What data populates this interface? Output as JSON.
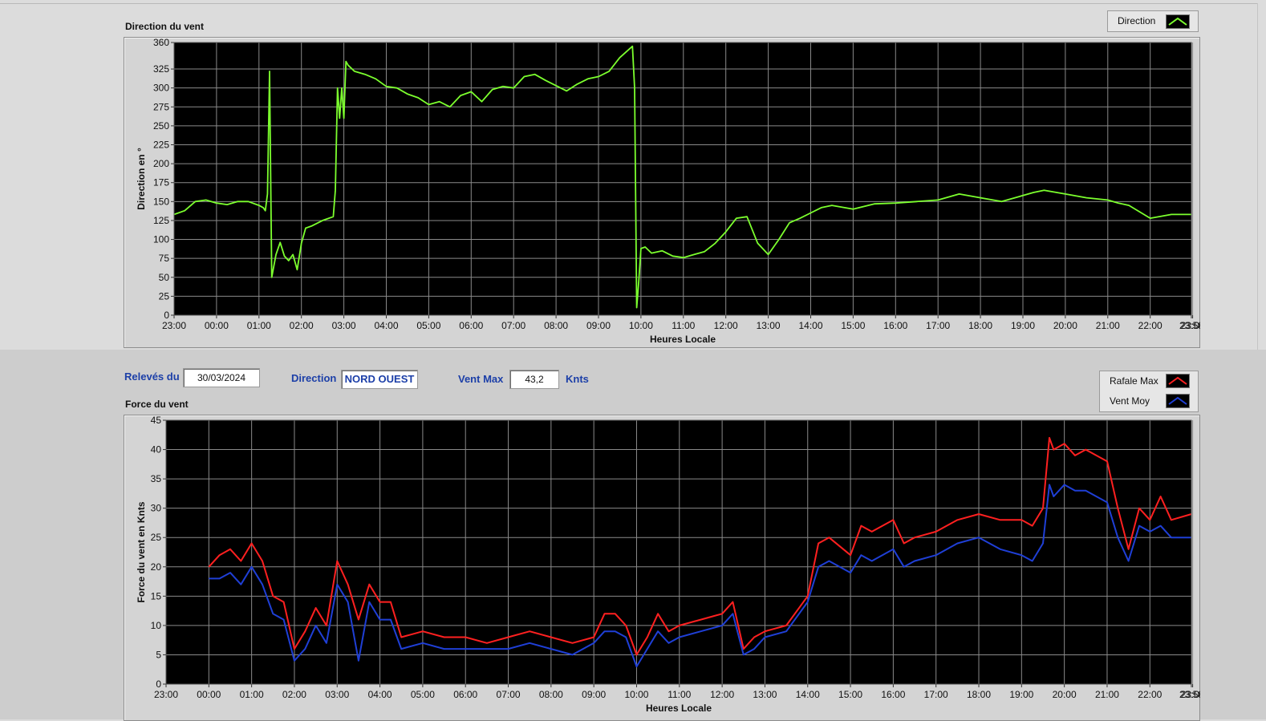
{
  "dir_chart": {
    "title": "Direction du vent",
    "legend": {
      "label": "Direction",
      "color": "#7cff2e"
    },
    "chart_data": {
      "type": "line",
      "title": "Direction du vent",
      "xlabel": "Heures Locale",
      "ylabel": "Direction en °",
      "ylim": [
        0,
        360
      ],
      "yticks": [
        "0",
        "25",
        "50",
        "75",
        "100",
        "125",
        "150",
        "175",
        "200",
        "225",
        "250",
        "275",
        "300",
        "325",
        "360"
      ],
      "yticks_values": [
        0,
        25,
        50,
        75,
        100,
        125,
        150,
        175,
        200,
        225,
        250,
        275,
        300,
        325,
        360
      ],
      "xticks": [
        "23:00",
        "00:00",
        "01:00",
        "02:00",
        "03:00",
        "04:00",
        "05:00",
        "06:00",
        "07:00",
        "08:00",
        "09:00",
        "10:00",
        "11:00",
        "12:00",
        "13:00",
        "14:00",
        "15:00",
        "16:00",
        "17:00",
        "18:00",
        "19:00",
        "20:00",
        "21:00",
        "22:00",
        "23:00",
        "23:58"
      ],
      "grid": true,
      "series": [
        {
          "name": "Direction",
          "color": "#7cff2e",
          "x": [
            0.0,
            0.25,
            0.5,
            0.75,
            1.0,
            1.25,
            1.5,
            1.75,
            2.0,
            2.1,
            2.15,
            2.2,
            2.25,
            2.3,
            2.4,
            2.5,
            2.6,
            2.7,
            2.8,
            2.9,
            3.0,
            3.1,
            3.25,
            3.5,
            3.75,
            3.8,
            3.85,
            3.9,
            3.95,
            4.0,
            4.05,
            4.1,
            4.25,
            4.5,
            4.75,
            5.0,
            5.25,
            5.5,
            5.75,
            6.0,
            6.25,
            6.5,
            6.75,
            7.0,
            7.25,
            7.5,
            7.75,
            8.0,
            8.25,
            8.5,
            8.75,
            9.0,
            9.25,
            9.5,
            9.75,
            10.0,
            10.25,
            10.5,
            10.7,
            10.8,
            10.85,
            10.9,
            10.95,
            11.0,
            11.1,
            11.25,
            11.5,
            11.75,
            12.0,
            12.25,
            12.5,
            12.75,
            13.0,
            13.25,
            13.5,
            13.75,
            14.0,
            14.25,
            14.5,
            14.75,
            15.0,
            15.25,
            15.5,
            16.0,
            16.5,
            17.0,
            17.5,
            18.0,
            18.5,
            19.0,
            19.5,
            20.0,
            20.25,
            20.5,
            21.0,
            21.5,
            22.0,
            22.25,
            22.5,
            23.0,
            23.5,
            23.97
          ],
          "y": [
            133,
            138,
            150,
            152,
            148,
            146,
            150,
            150,
            145,
            142,
            138,
            160,
            322,
            50,
            80,
            96,
            78,
            72,
            80,
            60,
            95,
            115,
            118,
            125,
            130,
            165,
            300,
            260,
            300,
            260,
            335,
            330,
            322,
            318,
            312,
            302,
            300,
            292,
            287,
            278,
            282,
            275,
            290,
            295,
            282,
            298,
            302,
            300,
            315,
            318,
            310,
            303,
            296,
            305,
            312,
            315,
            322,
            340,
            350,
            355,
            300,
            10,
            45,
            88,
            90,
            82,
            85,
            78,
            76,
            80,
            84,
            95,
            110,
            128,
            130,
            95,
            80,
            100,
            122,
            128,
            135,
            142,
            145,
            140,
            147,
            148,
            150,
            152,
            160,
            155,
            150,
            158,
            162,
            165,
            160,
            155,
            152,
            148,
            145,
            128,
            133,
            133
          ]
        }
      ]
    }
  },
  "info": {
    "releves_label": "Relevés du",
    "releves_value": "30/03/2024",
    "direction_label": "Direction",
    "direction_value": "NORD OUEST",
    "ventmax_label": "Vent Max",
    "ventmax_value": "43,2",
    "ventmax_unit": "Knts"
  },
  "force_chart": {
    "title": "Force du vent",
    "legend": [
      {
        "label": "Rafale Max",
        "color": "#ff2020"
      },
      {
        "label": "Vent Moy",
        "color": "#1f3fd6"
      }
    ],
    "chart_data": {
      "type": "line",
      "title": "Force du vent",
      "xlabel": "Heures Locale",
      "ylabel": "Force du vent en Knts",
      "ylim": [
        0,
        45
      ],
      "yticks": [
        "0",
        "5",
        "10",
        "15",
        "20",
        "25",
        "30",
        "35",
        "40",
        "45"
      ],
      "yticks_values": [
        0,
        5,
        10,
        15,
        20,
        25,
        30,
        35,
        40,
        45
      ],
      "xticks": [
        "23:00",
        "00:00",
        "01:00",
        "02:00",
        "03:00",
        "04:00",
        "05:00",
        "06:00",
        "07:00",
        "08:00",
        "09:00",
        "10:00",
        "11:00",
        "12:00",
        "13:00",
        "14:00",
        "15:00",
        "16:00",
        "17:00",
        "18:00",
        "19:00",
        "20:00",
        "21:00",
        "22:00",
        "23:00",
        "23:58"
      ],
      "grid": true,
      "series": [
        {
          "name": "Rafale Max",
          "color": "#ff2020",
          "x": [
            1.0,
            1.25,
            1.5,
            1.75,
            2.0,
            2.25,
            2.5,
            2.75,
            3.0,
            3.25,
            3.5,
            3.75,
            4.0,
            4.25,
            4.5,
            4.75,
            5.0,
            5.25,
            5.5,
            6.0,
            6.5,
            7.0,
            7.5,
            8.0,
            8.5,
            9.0,
            9.5,
            10.0,
            10.25,
            10.5,
            10.75,
            11.0,
            11.25,
            11.5,
            11.75,
            12.0,
            12.5,
            13.0,
            13.25,
            13.5,
            13.75,
            14.0,
            14.5,
            15.0,
            15.25,
            15.5,
            16.0,
            16.25,
            16.5,
            17.0,
            17.25,
            17.5,
            18.0,
            18.5,
            19.0,
            19.5,
            20.0,
            20.25,
            20.5,
            20.65,
            20.75,
            21.0,
            21.25,
            21.5,
            22.0,
            22.25,
            22.5,
            22.75,
            23.0,
            23.25,
            23.5,
            23.97
          ],
          "y": [
            20,
            22,
            23,
            21,
            24,
            21,
            15,
            14,
            6,
            9,
            13,
            10,
            21,
            17,
            11,
            17,
            14,
            14,
            8,
            9,
            8,
            8,
            7,
            8,
            9,
            8,
            7,
            8,
            12,
            12,
            10,
            5,
            8,
            12,
            9,
            10,
            11,
            12,
            14,
            6,
            8,
            9,
            10,
            15,
            24,
            25,
            22,
            27,
            26,
            28,
            24,
            25,
            26,
            28,
            29,
            28,
            28,
            27,
            30,
            42,
            40,
            41,
            39,
            40,
            38,
            30,
            23,
            30,
            28,
            32,
            28,
            29
          ]
        },
        {
          "name": "Vent Moy",
          "color": "#1f3fd6",
          "x": [
            1.0,
            1.25,
            1.5,
            1.75,
            2.0,
            2.25,
            2.5,
            2.75,
            3.0,
            3.25,
            3.5,
            3.75,
            4.0,
            4.25,
            4.5,
            4.75,
            5.0,
            5.25,
            5.5,
            6.0,
            6.5,
            7.0,
            7.5,
            8.0,
            8.5,
            9.0,
            9.5,
            10.0,
            10.25,
            10.5,
            10.75,
            11.0,
            11.25,
            11.5,
            11.75,
            12.0,
            12.5,
            13.0,
            13.25,
            13.5,
            13.75,
            14.0,
            14.5,
            15.0,
            15.25,
            15.5,
            16.0,
            16.25,
            16.5,
            17.0,
            17.25,
            17.5,
            18.0,
            18.5,
            19.0,
            19.5,
            20.0,
            20.25,
            20.5,
            20.65,
            20.75,
            21.0,
            21.25,
            21.5,
            22.0,
            22.25,
            22.5,
            22.75,
            23.0,
            23.25,
            23.5,
            23.97
          ],
          "y": [
            18,
            18,
            19,
            17,
            20,
            17,
            12,
            11,
            4,
            6,
            10,
            7,
            17,
            14,
            4,
            14,
            11,
            11,
            6,
            7,
            6,
            6,
            6,
            6,
            7,
            6,
            5,
            7,
            9,
            9,
            8,
            3,
            6,
            9,
            7,
            8,
            9,
            10,
            12,
            5,
            6,
            8,
            9,
            14,
            20,
            21,
            19,
            22,
            21,
            23,
            20,
            21,
            22,
            24,
            25,
            23,
            22,
            21,
            24,
            34,
            32,
            34,
            33,
            33,
            31,
            25,
            21,
            27,
            26,
            27,
            25,
            25
          ]
        }
      ]
    }
  }
}
